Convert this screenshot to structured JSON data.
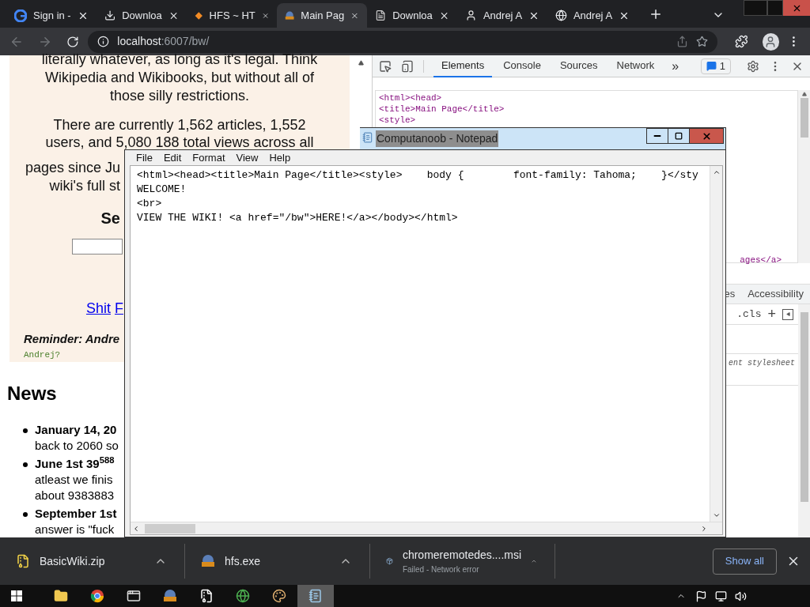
{
  "browser": {
    "tabs": [
      {
        "title": "Sign in -",
        "kind": "google",
        "selected": false
      },
      {
        "title": "Downloa",
        "kind": "download",
        "selected": false
      },
      {
        "title": "HFS ~ HT",
        "kind": "diamond",
        "selected": false
      },
      {
        "title": "Main Pag",
        "kind": "hfs",
        "selected": true
      },
      {
        "title": "Downloa",
        "kind": "document",
        "selected": false
      },
      {
        "title": "Andrej A",
        "kind": "figure",
        "selected": false
      },
      {
        "title": "Andrej A",
        "kind": "globe",
        "selected": false
      }
    ],
    "address": {
      "host": "localhost",
      "path": ":6007/bw/"
    }
  },
  "page": {
    "intro_lines": [
      "literally whatever, as long as it's legal. Think",
      "Wikipedia and Wikibooks, but without all of",
      "those silly restrictions."
    ],
    "stats_lines": [
      "There are currently 1,562 articles, 1,552",
      "users, and 5,080 188 total views across all"
    ],
    "stats_partial_lines": [
      "pages since Ju",
      "wiki's full st"
    ],
    "search_heading": "Se",
    "links": [
      "Shit",
      "F"
    ],
    "reminder": "Reminder: Andre",
    "reminder_note": "Andrej?",
    "news_heading": "News",
    "news": [
      {
        "title": "January 14, 20",
        "lines": [
          "back to 2060 so"
        ]
      },
      {
        "title": "June 1st 39$^{588}$",
        "lines": [
          "atleast we finis",
          "about 9383883"
        ]
      },
      {
        "title": "September 1st",
        "lines": [
          "answer is \"fuck"
        ]
      }
    ]
  },
  "devtools": {
    "tabs": [
      {
        "label": "Elements",
        "selected": true
      },
      {
        "label": "Console",
        "selected": false
      },
      {
        "label": "Sources",
        "selected": false
      },
      {
        "label": "Network",
        "selected": false
      }
    ],
    "more": "»",
    "issues_count": "1",
    "dom_lines": [
      "<html><head>",
      "<title>Main Page</title>",
      "<style>"
    ],
    "dom_tail": "ages</a>",
    "lower_tabs": [
      {
        "label": "es",
        "selected": false
      },
      {
        "label": "Accessibility",
        "selected": false
      }
    ],
    "cls": ".cls",
    "plus": "+",
    "stylesheet_note": "ent stylesheet"
  },
  "notepad": {
    "title": "Computanoob - Notepad",
    "menu": [
      "File",
      "Edit",
      "Format",
      "View",
      "Help"
    ],
    "lines": [
      "<html><head><title>Main Page</title><style>    body {        font-family: Tahoma;    }</sty",
      "WELCOME!",
      "<br>",
      "VIEW THE WIKI! <a href=\"/bw\">HERE!</a></body></html>"
    ]
  },
  "downloads": {
    "items": [
      {
        "name": "BasicWiki.zip",
        "kind": "zip"
      },
      {
        "name": "hfs.exe",
        "kind": "hfs"
      },
      {
        "name": "chromeremotedes....msi",
        "kind": "msi",
        "status": "Failed - Network error"
      }
    ],
    "show_all": "Show all"
  },
  "taskbar": {
    "apps": [
      {
        "kind": "explorer",
        "selected": false
      },
      {
        "kind": "chrome",
        "selected": false
      },
      {
        "kind": "window",
        "selected": false
      },
      {
        "kind": "hfs",
        "selected": false
      },
      {
        "kind": "archive",
        "selected": false
      },
      {
        "kind": "globe",
        "selected": false
      },
      {
        "kind": "paint",
        "selected": false
      },
      {
        "kind": "notepad",
        "selected": true
      }
    ]
  }
}
